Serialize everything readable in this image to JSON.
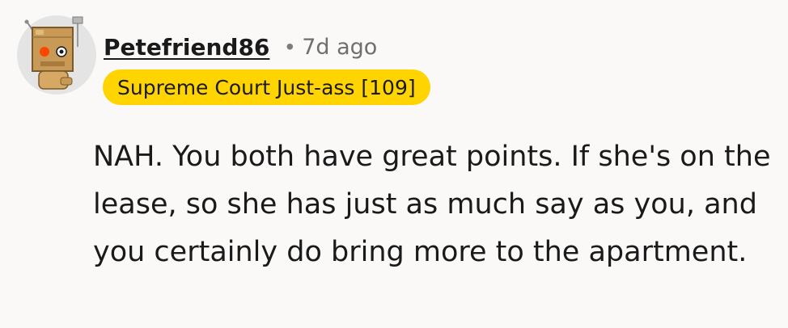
{
  "comment": {
    "author": {
      "username": "Petefriend86",
      "avatar_icon": "snoo-robot-box-avatar-icon"
    },
    "timestamp": "7d ago",
    "separator": "•",
    "flair": {
      "text": "Supreme Court Just-ass [109]",
      "background_color": "#ffd401"
    },
    "body": "NAH. You both have great points. If she's on the lease, so she has just as much say as you, and you certainly do bring more to the apartment."
  }
}
